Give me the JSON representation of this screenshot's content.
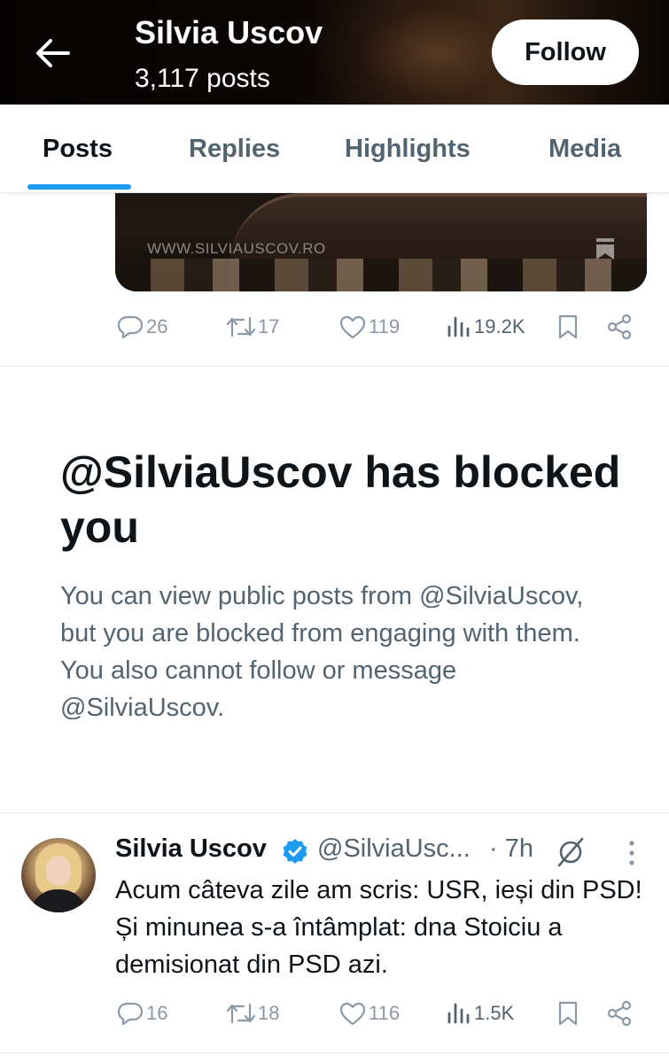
{
  "header": {
    "name": "Silvia Uscov",
    "posts_count": "3,117 posts",
    "follow_label": "Follow"
  },
  "tabs": [
    {
      "label": "Posts",
      "active": true
    },
    {
      "label": "Replies",
      "active": false
    },
    {
      "label": "Highlights",
      "active": false
    },
    {
      "label": "Media",
      "active": false
    }
  ],
  "previous_post": {
    "media_watermark": "WWW.SILVIAUSCOV.RO",
    "replies": "26",
    "reposts": "17",
    "likes": "119",
    "views": "19.2K"
  },
  "blocked_notice": {
    "title": "@SilviaUscov has blocked you",
    "body": "You can view public posts from @SilviaUscov, but you are blocked from engaging with them. You also cannot follow or message @SilviaUscov."
  },
  "tweet": {
    "author": "Silvia Uscov",
    "handle": "@SilviaUsc...",
    "time": "· 7h",
    "text": "Acum câteva zile am scris: USR, ieși din PSD! Și minunea s-a întâmplat: dna Stoiciu a demisionat din PSD azi.",
    "replies": "16",
    "reposts": "18",
    "likes": "116",
    "views": "1.5K"
  },
  "colors": {
    "accent": "#1d9bf0",
    "text_primary": "#0f1419",
    "text_secondary": "#536471",
    "icon_muted": "#8b98a5"
  },
  "icons": [
    "back-arrow-icon",
    "reply-icon",
    "repost-icon",
    "like-icon",
    "views-icon",
    "bookmark-icon",
    "share-icon",
    "verified-badge-icon",
    "grok-icon",
    "more-icon"
  ]
}
